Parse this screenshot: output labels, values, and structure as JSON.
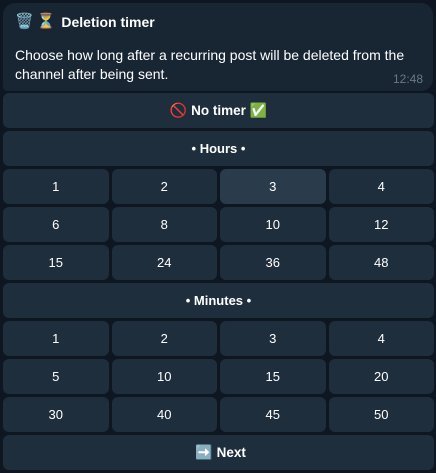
{
  "message": {
    "icons": [
      "🗑️",
      "⏳"
    ],
    "icon_names": [
      "wastebasket-icon",
      "hourglass-icon"
    ],
    "title": "Deletion timer",
    "text": "Choose how long after a recurring post will be deleted from the channel after being sent.",
    "time": "12:48"
  },
  "keyboard": {
    "no_timer": {
      "prefix": "🚫",
      "label": "No timer",
      "suffix": "✅"
    },
    "hours_header": "• Hours •",
    "hours": [
      [
        "1",
        "2",
        "3",
        "4"
      ],
      [
        "6",
        "8",
        "10",
        "12"
      ],
      [
        "15",
        "24",
        "36",
        "48"
      ]
    ],
    "minutes_header": "• Minutes •",
    "minutes": [
      [
        "1",
        "2",
        "3",
        "4"
      ],
      [
        "5",
        "10",
        "15",
        "20"
      ],
      [
        "30",
        "40",
        "45",
        "50"
      ]
    ],
    "next": {
      "prefix": "➡️",
      "label": "Next"
    }
  },
  "colors": {
    "background": "#0e1621",
    "bubble": "#182533",
    "button": "#1f2e3c",
    "button_hover": "#2a3b4c",
    "time": "#6c7883"
  }
}
